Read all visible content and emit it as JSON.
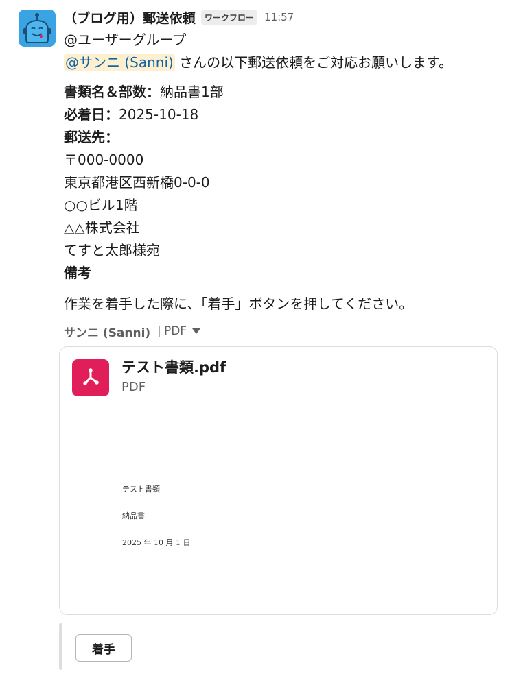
{
  "message": {
    "sender": "（ブログ用）郵送依頼",
    "badge": "ワークフロー",
    "time": "11:57",
    "group_mention": "@ユーザーグループ",
    "user_mention": "@サンニ (Sanni)",
    "request_text": "さんの以下郵送依頼をご対応お願いします。",
    "fields": {
      "doc_label": "書類名＆部数：",
      "doc_value": "納品書1部",
      "date_label": "必着日：",
      "date_value": "2025-10-18",
      "address_label": "郵送先：",
      "address_lines": [
        "〒000-0000",
        "東京都港区西新橋0-0-0",
        "○○ビル1階",
        "△△株式会社",
        "てすと太郎様宛"
      ],
      "notes_label": "備考"
    },
    "notice": "作業を着手した際に、「着手」ボタンを押してください。"
  },
  "file": {
    "uploader": "サンニ (Sanni)",
    "separator": "|",
    "meta_type": "PDF",
    "name": "テスト書類.pdf",
    "type": "PDF",
    "icon": "pdf-icon",
    "preview_lines": [
      "テスト書類",
      "納品書",
      "2025 年 10 月 1 日"
    ]
  },
  "action": {
    "button_label": "着手"
  },
  "colors": {
    "avatar_bg": "#3aa3e3",
    "pdf_icon_bg": "#e01e5a",
    "mention_bg": "#fdf0d1",
    "mention_text": "#1264a3"
  }
}
